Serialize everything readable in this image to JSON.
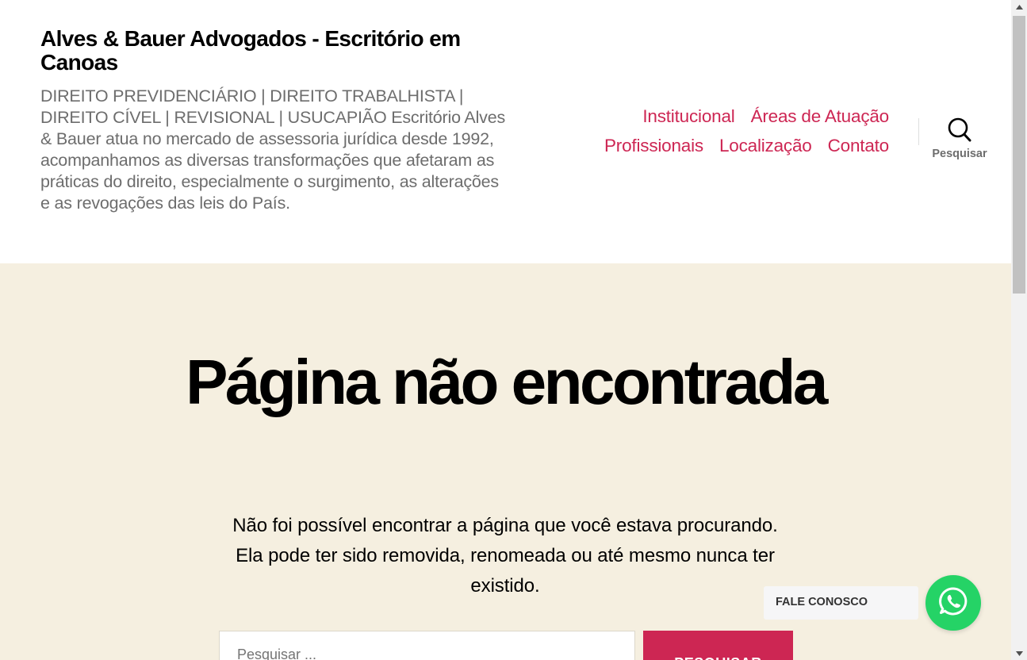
{
  "header": {
    "site_title": "Alves & Bauer Advogados - Escritório em Canoas",
    "site_description": "DIREITO PREVIDENCIÁRIO | DIREITO TRABALHISTA | DIREITO CÍVEL | REVISIONAL | USUCAPIÃO Escritório Alves & Bauer atua no mercado de assessoria jurídica desde 1992, acompanhamos as diversas transformações que afetaram as práticas do direito, especialmente o surgimento, as alterações e as revogações das leis do País.",
    "nav": {
      "row1": [
        "Institucional",
        "Áreas de Atuação"
      ],
      "row2": [
        "Profissionais",
        "Localização",
        "Contato"
      ]
    },
    "search_toggle_label": "Pesquisar",
    "search_icon": "search-icon"
  },
  "main": {
    "title": "Página não encontrada",
    "text": "Não foi possível encontrar a página que você estava procurando. Ela pode ter sido removida, renomeada ou até mesmo nunca ter existido.",
    "search": {
      "placeholder": "Pesquisar ...",
      "button_label": "Pesquisar"
    }
  },
  "whatsapp": {
    "label": "FALE CONOSCO",
    "icon": "whatsapp-icon",
    "color": "#25d366"
  },
  "colors": {
    "accent": "#cd2653",
    "background": "#f5efe0",
    "header_bg": "#ffffff"
  }
}
